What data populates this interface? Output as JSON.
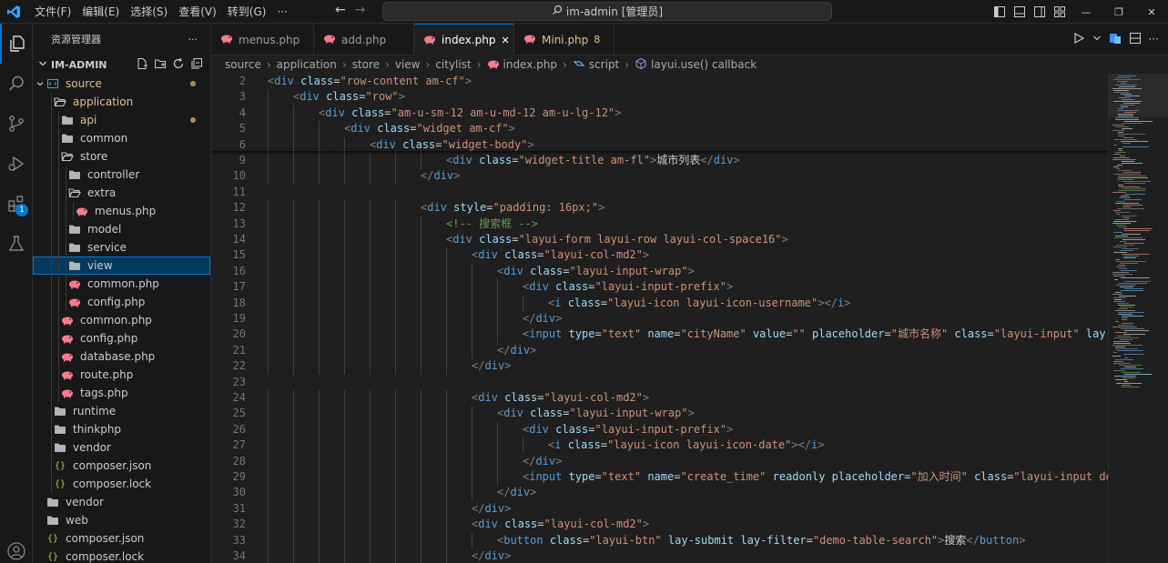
{
  "titlebar": {
    "menus": [
      "文件(F)",
      "编辑(E)",
      "选择(S)",
      "查看(V)",
      "转到(G)",
      "···"
    ],
    "command_center": "im-admin [管理员]"
  },
  "sidebar": {
    "title": "资源管理器",
    "more": "···",
    "project": "IM-ADMIN",
    "tree": [
      {
        "label": "source",
        "depth": 0,
        "icon": "folder-source-icon",
        "open": true,
        "mod": true,
        "dot": true,
        "arrow": true
      },
      {
        "label": "application",
        "depth": 1,
        "icon": "folder-open-icon",
        "open": true,
        "mod": true,
        "dot": false
      },
      {
        "label": "api",
        "depth": 2,
        "icon": "folder-icon",
        "mod": true,
        "dot": true
      },
      {
        "label": "common",
        "depth": 2,
        "icon": "folder-icon"
      },
      {
        "label": "store",
        "depth": 2,
        "icon": "folder-open-icon"
      },
      {
        "label": "controller",
        "depth": 3,
        "icon": "folder-icon"
      },
      {
        "label": "extra",
        "depth": 3,
        "icon": "folder-open-icon"
      },
      {
        "label": "menus.php",
        "depth": 4,
        "icon": "php-file-icon"
      },
      {
        "label": "model",
        "depth": 3,
        "icon": "folder-icon"
      },
      {
        "label": "service",
        "depth": 3,
        "icon": "folder-icon"
      },
      {
        "label": "view",
        "depth": 3,
        "icon": "folder-icon",
        "selected": true
      },
      {
        "label": "common.php",
        "depth": 3,
        "icon": "php-file-icon"
      },
      {
        "label": "config.php",
        "depth": 3,
        "icon": "php-file-icon"
      },
      {
        "label": "common.php",
        "depth": 2,
        "icon": "php-file-icon"
      },
      {
        "label": "config.php",
        "depth": 2,
        "icon": "php-file-icon"
      },
      {
        "label": "database.php",
        "depth": 2,
        "icon": "php-file-icon"
      },
      {
        "label": "route.php",
        "depth": 2,
        "icon": "php-file-icon"
      },
      {
        "label": "tags.php",
        "depth": 2,
        "icon": "php-file-icon"
      },
      {
        "label": "runtime",
        "depth": 1,
        "icon": "folder-icon"
      },
      {
        "label": "thinkphp",
        "depth": 1,
        "icon": "folder-icon"
      },
      {
        "label": "vendor",
        "depth": 1,
        "icon": "folder-icon"
      },
      {
        "label": "composer.json",
        "depth": 1,
        "icon": "json-file-icon"
      },
      {
        "label": "composer.lock",
        "depth": 1,
        "icon": "json-file-icon"
      },
      {
        "label": "vendor",
        "depth": 0,
        "icon": "folder-icon"
      },
      {
        "label": "web",
        "depth": 0,
        "icon": "folder-icon"
      },
      {
        "label": "composer.json",
        "depth": 0,
        "icon": "json-file-icon"
      },
      {
        "label": "composer.lock",
        "depth": 0,
        "icon": "json-file-icon"
      }
    ]
  },
  "activity": {
    "extensions_badge": "1"
  },
  "tabs": [
    {
      "label": "menus.php",
      "active": false
    },
    {
      "label": "add.php",
      "active": false
    },
    {
      "label": "index.php",
      "active": true,
      "close": "✕"
    },
    {
      "label": "Mini.php",
      "active": false,
      "mod": true,
      "count": "8"
    }
  ],
  "breadcrumb": [
    {
      "label": "source"
    },
    {
      "label": "application"
    },
    {
      "label": "store"
    },
    {
      "label": "view"
    },
    {
      "label": "citylist"
    },
    {
      "label": "index.php",
      "icon": "php-file-icon"
    },
    {
      "label": "script",
      "icon": "symbol-script-icon"
    },
    {
      "label": "layui.use() callback",
      "icon": "symbol-method-icon"
    }
  ],
  "colors": {
    "accent": "#0078d4",
    "php_icon": "#f77b8f",
    "folder": "#c5c5c5",
    "modified": "#e2c08d"
  },
  "code": [
    {
      "n": "2",
      "indent": 0,
      "tokens": [
        [
          "br",
          "<"
        ],
        [
          "tag",
          "div"
        ],
        [
          "sp",
          " "
        ],
        [
          "attr",
          "class"
        ],
        [
          "eq",
          "="
        ],
        [
          "str",
          "\"row-content am-cf\""
        ],
        [
          "br",
          ">"
        ]
      ]
    },
    {
      "n": "3",
      "indent": 1,
      "tokens": [
        [
          "br",
          "<"
        ],
        [
          "tag",
          "div"
        ],
        [
          "sp",
          " "
        ],
        [
          "attr",
          "class"
        ],
        [
          "eq",
          "="
        ],
        [
          "str",
          "\"row\""
        ],
        [
          "br",
          ">"
        ]
      ]
    },
    {
      "n": "4",
      "indent": 2,
      "tokens": [
        [
          "br",
          "<"
        ],
        [
          "tag",
          "div"
        ],
        [
          "sp",
          " "
        ],
        [
          "attr",
          "class"
        ],
        [
          "eq",
          "="
        ],
        [
          "str",
          "\"am-u-sm-12 am-u-md-12 am-u-lg-12\""
        ],
        [
          "br",
          ">"
        ]
      ]
    },
    {
      "n": "5",
      "indent": 3,
      "tokens": [
        [
          "br",
          "<"
        ],
        [
          "tag",
          "div"
        ],
        [
          "sp",
          " "
        ],
        [
          "attr",
          "class"
        ],
        [
          "eq",
          "="
        ],
        [
          "str",
          "\"widget am-cf\""
        ],
        [
          "br",
          ">"
        ]
      ]
    },
    {
      "n": "6",
      "indent": 4,
      "tokens": [
        [
          "br",
          "<"
        ],
        [
          "tag",
          "div"
        ],
        [
          "sp",
          " "
        ],
        [
          "attr",
          "class"
        ],
        [
          "eq",
          "="
        ],
        [
          "str",
          "\"widget-body\""
        ],
        [
          "br",
          ">"
        ]
      ]
    },
    {
      "n": "9",
      "indent": 7,
      "tokens": [
        [
          "br",
          "<"
        ],
        [
          "tag",
          "div"
        ],
        [
          "sp",
          " "
        ],
        [
          "attr",
          "class"
        ],
        [
          "eq",
          "="
        ],
        [
          "str",
          "\"widget-title am-fl\""
        ],
        [
          "br",
          ">"
        ],
        [
          "txt",
          "城市列表"
        ],
        [
          "br",
          "</"
        ],
        [
          "tag",
          "div"
        ],
        [
          "br",
          ">"
        ]
      ]
    },
    {
      "n": "10",
      "indent": 6,
      "tokens": [
        [
          "br",
          "</"
        ],
        [
          "tag",
          "div"
        ],
        [
          "br",
          ">"
        ]
      ]
    },
    {
      "n": "11",
      "indent": 0,
      "tokens": []
    },
    {
      "n": "12",
      "indent": 6,
      "tokens": [
        [
          "br",
          "<"
        ],
        [
          "tag",
          "div"
        ],
        [
          "sp",
          " "
        ],
        [
          "attr",
          "style"
        ],
        [
          "eq",
          "="
        ],
        [
          "str",
          "\"padding: 16px;\""
        ],
        [
          "br",
          ">"
        ]
      ]
    },
    {
      "n": "13",
      "indent": 7,
      "tokens": [
        [
          "com",
          "<!-- 搜索框 -->"
        ]
      ]
    },
    {
      "n": "14",
      "indent": 7,
      "tokens": [
        [
          "br",
          "<"
        ],
        [
          "tag",
          "div"
        ],
        [
          "sp",
          " "
        ],
        [
          "attr",
          "class"
        ],
        [
          "eq",
          "="
        ],
        [
          "str",
          "\"layui-form layui-row layui-col-space16\""
        ],
        [
          "br",
          ">"
        ]
      ]
    },
    {
      "n": "15",
      "indent": 8,
      "tokens": [
        [
          "br",
          "<"
        ],
        [
          "tag",
          "div"
        ],
        [
          "sp",
          " "
        ],
        [
          "attr",
          "class"
        ],
        [
          "eq",
          "="
        ],
        [
          "str",
          "\"layui-col-md2\""
        ],
        [
          "br",
          ">"
        ]
      ]
    },
    {
      "n": "16",
      "indent": 9,
      "tokens": [
        [
          "br",
          "<"
        ],
        [
          "tag",
          "div"
        ],
        [
          "sp",
          " "
        ],
        [
          "attr",
          "class"
        ],
        [
          "eq",
          "="
        ],
        [
          "str",
          "\"layui-input-wrap\""
        ],
        [
          "br",
          ">"
        ]
      ]
    },
    {
      "n": "17",
      "indent": 10,
      "tokens": [
        [
          "br",
          "<"
        ],
        [
          "tag",
          "div"
        ],
        [
          "sp",
          " "
        ],
        [
          "attr",
          "class"
        ],
        [
          "eq",
          "="
        ],
        [
          "str",
          "\"layui-input-prefix\""
        ],
        [
          "br",
          ">"
        ]
      ]
    },
    {
      "n": "18",
      "indent": 11,
      "tokens": [
        [
          "br",
          "<"
        ],
        [
          "tag",
          "i"
        ],
        [
          "sp",
          " "
        ],
        [
          "attr",
          "class"
        ],
        [
          "eq",
          "="
        ],
        [
          "str",
          "\"layui-icon layui-icon-username\""
        ],
        [
          "br",
          ">"
        ],
        [
          "br",
          "</"
        ],
        [
          "tag",
          "i"
        ],
        [
          "br",
          ">"
        ]
      ]
    },
    {
      "n": "19",
      "indent": 10,
      "tokens": [
        [
          "br",
          "</"
        ],
        [
          "tag",
          "div"
        ],
        [
          "br",
          ">"
        ]
      ]
    },
    {
      "n": "20",
      "indent": 10,
      "tokens": [
        [
          "br",
          "<"
        ],
        [
          "tag",
          "input"
        ],
        [
          "sp",
          " "
        ],
        [
          "attr",
          "type"
        ],
        [
          "eq",
          "="
        ],
        [
          "str",
          "\"text\""
        ],
        [
          "sp",
          " "
        ],
        [
          "attr",
          "name"
        ],
        [
          "eq",
          "="
        ],
        [
          "str",
          "\"cityName\""
        ],
        [
          "sp",
          " "
        ],
        [
          "attr",
          "value"
        ],
        [
          "eq",
          "="
        ],
        [
          "str",
          "\"\""
        ],
        [
          "sp",
          " "
        ],
        [
          "attr",
          "placeholder"
        ],
        [
          "eq",
          "="
        ],
        [
          "str",
          "\"城市名称\""
        ],
        [
          "sp",
          " "
        ],
        [
          "attr",
          "class"
        ],
        [
          "eq",
          "="
        ],
        [
          "str",
          "\"layui-input\""
        ],
        [
          "sp",
          " "
        ],
        [
          "attr",
          "lay-af"
        ]
      ]
    },
    {
      "n": "21",
      "indent": 9,
      "tokens": [
        [
          "br",
          "</"
        ],
        [
          "tag",
          "div"
        ],
        [
          "br",
          ">"
        ]
      ]
    },
    {
      "n": "22",
      "indent": 8,
      "tokens": [
        [
          "br",
          "</"
        ],
        [
          "tag",
          "div"
        ],
        [
          "br",
          ">"
        ]
      ]
    },
    {
      "n": "23",
      "indent": 0,
      "tokens": []
    },
    {
      "n": "24",
      "indent": 8,
      "tokens": [
        [
          "br",
          "<"
        ],
        [
          "tag",
          "div"
        ],
        [
          "sp",
          " "
        ],
        [
          "attr",
          "class"
        ],
        [
          "eq",
          "="
        ],
        [
          "str",
          "\"layui-col-md2\""
        ],
        [
          "br",
          ">"
        ]
      ]
    },
    {
      "n": "25",
      "indent": 9,
      "tokens": [
        [
          "br",
          "<"
        ],
        [
          "tag",
          "div"
        ],
        [
          "sp",
          " "
        ],
        [
          "attr",
          "class"
        ],
        [
          "eq",
          "="
        ],
        [
          "str",
          "\"layui-input-wrap\""
        ],
        [
          "br",
          ">"
        ]
      ]
    },
    {
      "n": "26",
      "indent": 10,
      "tokens": [
        [
          "br",
          "<"
        ],
        [
          "tag",
          "div"
        ],
        [
          "sp",
          " "
        ],
        [
          "attr",
          "class"
        ],
        [
          "eq",
          "="
        ],
        [
          "str",
          "\"layui-input-prefix\""
        ],
        [
          "br",
          ">"
        ]
      ]
    },
    {
      "n": "27",
      "indent": 11,
      "tokens": [
        [
          "br",
          "<"
        ],
        [
          "tag",
          "i"
        ],
        [
          "sp",
          " "
        ],
        [
          "attr",
          "class"
        ],
        [
          "eq",
          "="
        ],
        [
          "str",
          "\"layui-icon layui-icon-date\""
        ],
        [
          "br",
          ">"
        ],
        [
          "br",
          "</"
        ],
        [
          "tag",
          "i"
        ],
        [
          "br",
          ">"
        ]
      ]
    },
    {
      "n": "28",
      "indent": 10,
      "tokens": [
        [
          "br",
          "</"
        ],
        [
          "tag",
          "div"
        ],
        [
          "br",
          ">"
        ]
      ]
    },
    {
      "n": "29",
      "indent": 10,
      "tokens": [
        [
          "br",
          "<"
        ],
        [
          "tag",
          "input"
        ],
        [
          "sp",
          " "
        ],
        [
          "attr",
          "type"
        ],
        [
          "eq",
          "="
        ],
        [
          "str",
          "\"text\""
        ],
        [
          "sp",
          " "
        ],
        [
          "attr",
          "name"
        ],
        [
          "eq",
          "="
        ],
        [
          "str",
          "\"create_time\""
        ],
        [
          "sp",
          " "
        ],
        [
          "attr",
          "readonly"
        ],
        [
          "sp",
          " "
        ],
        [
          "attr",
          "placeholder"
        ],
        [
          "eq",
          "="
        ],
        [
          "str",
          "\"加入时间\""
        ],
        [
          "sp",
          " "
        ],
        [
          "attr",
          "class"
        ],
        [
          "eq",
          "="
        ],
        [
          "str",
          "\"layui-input demo"
        ]
      ]
    },
    {
      "n": "30",
      "indent": 9,
      "tokens": [
        [
          "br",
          "</"
        ],
        [
          "tag",
          "div"
        ],
        [
          "br",
          ">"
        ]
      ]
    },
    {
      "n": "31",
      "indent": 8,
      "tokens": [
        [
          "br",
          "</"
        ],
        [
          "tag",
          "div"
        ],
        [
          "br",
          ">"
        ]
      ]
    },
    {
      "n": "32",
      "indent": 8,
      "tokens": [
        [
          "br",
          "<"
        ],
        [
          "tag",
          "div"
        ],
        [
          "sp",
          " "
        ],
        [
          "attr",
          "class"
        ],
        [
          "eq",
          "="
        ],
        [
          "str",
          "\"layui-col-md2\""
        ],
        [
          "br",
          ">"
        ]
      ]
    },
    {
      "n": "33",
      "indent": 9,
      "tokens": [
        [
          "br",
          "<"
        ],
        [
          "tag",
          "button"
        ],
        [
          "sp",
          " "
        ],
        [
          "attr",
          "class"
        ],
        [
          "eq",
          "="
        ],
        [
          "str",
          "\"layui-btn\""
        ],
        [
          "sp",
          " "
        ],
        [
          "attr",
          "lay-submit"
        ],
        [
          "sp",
          " "
        ],
        [
          "attr",
          "lay-filter"
        ],
        [
          "eq",
          "="
        ],
        [
          "str",
          "\"demo-table-search\""
        ],
        [
          "br",
          ">"
        ],
        [
          "txt",
          "搜索"
        ],
        [
          "br",
          "</"
        ],
        [
          "tag",
          "button"
        ],
        [
          "br",
          ">"
        ]
      ]
    },
    {
      "n": "34",
      "indent": 8,
      "tokens": [
        [
          "br",
          "</"
        ],
        [
          "tag",
          "div"
        ],
        [
          "br",
          ">"
        ]
      ]
    }
  ]
}
